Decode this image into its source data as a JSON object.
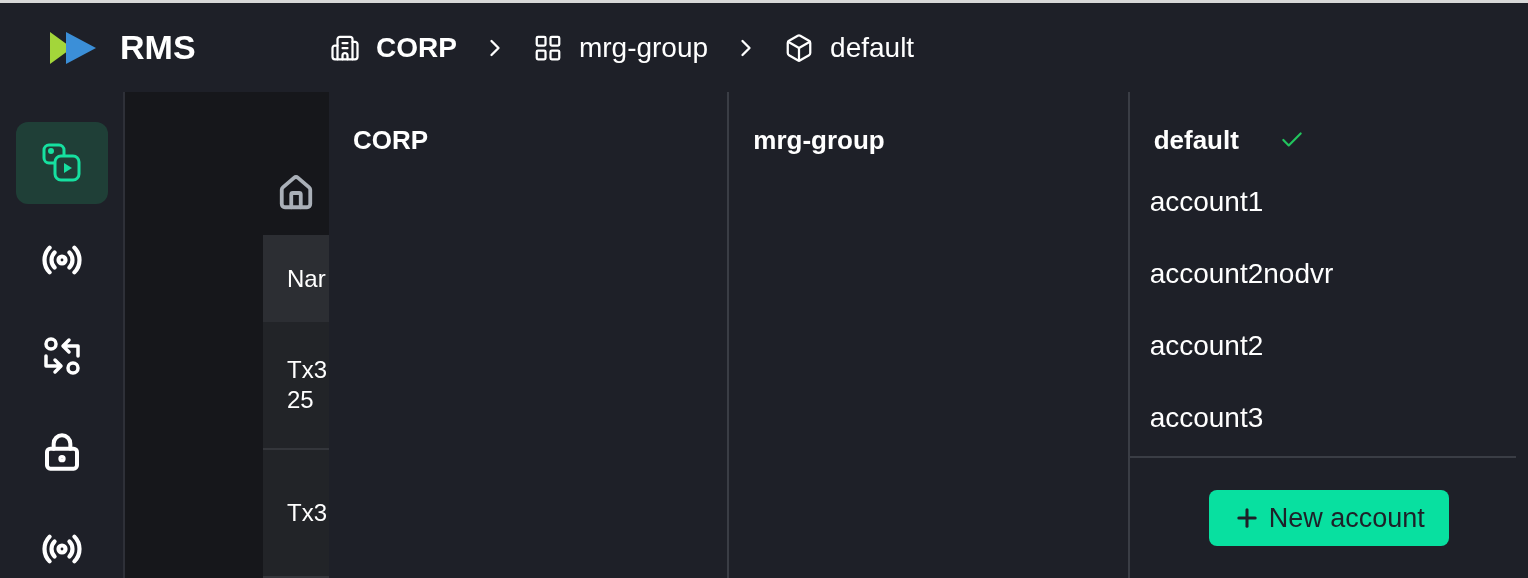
{
  "app": {
    "name": "RMS"
  },
  "breadcrumb": [
    {
      "kind": "building",
      "label": "CORP"
    },
    {
      "kind": "grid",
      "label": "mrg-group"
    },
    {
      "kind": "box",
      "label": "default"
    }
  ],
  "sidebar": {
    "items": [
      {
        "kind": "media",
        "selected": true
      },
      {
        "kind": "broadcast",
        "selected": false
      },
      {
        "kind": "swap",
        "selected": false
      },
      {
        "kind": "lock",
        "selected": false
      },
      {
        "kind": "broadcast",
        "selected": false
      }
    ]
  },
  "background_table": {
    "header": "Nar",
    "rows": [
      [
        "Tx3",
        "25"
      ],
      [
        "Tx3"
      ]
    ]
  },
  "columns": [
    {
      "title": "CORP",
      "checked": false
    },
    {
      "title": "mrg-group",
      "checked": false
    },
    {
      "title": "default",
      "checked": true,
      "items": [
        "account1",
        "account2nodvr",
        "account2",
        "account3"
      ],
      "button": "New account"
    }
  ]
}
